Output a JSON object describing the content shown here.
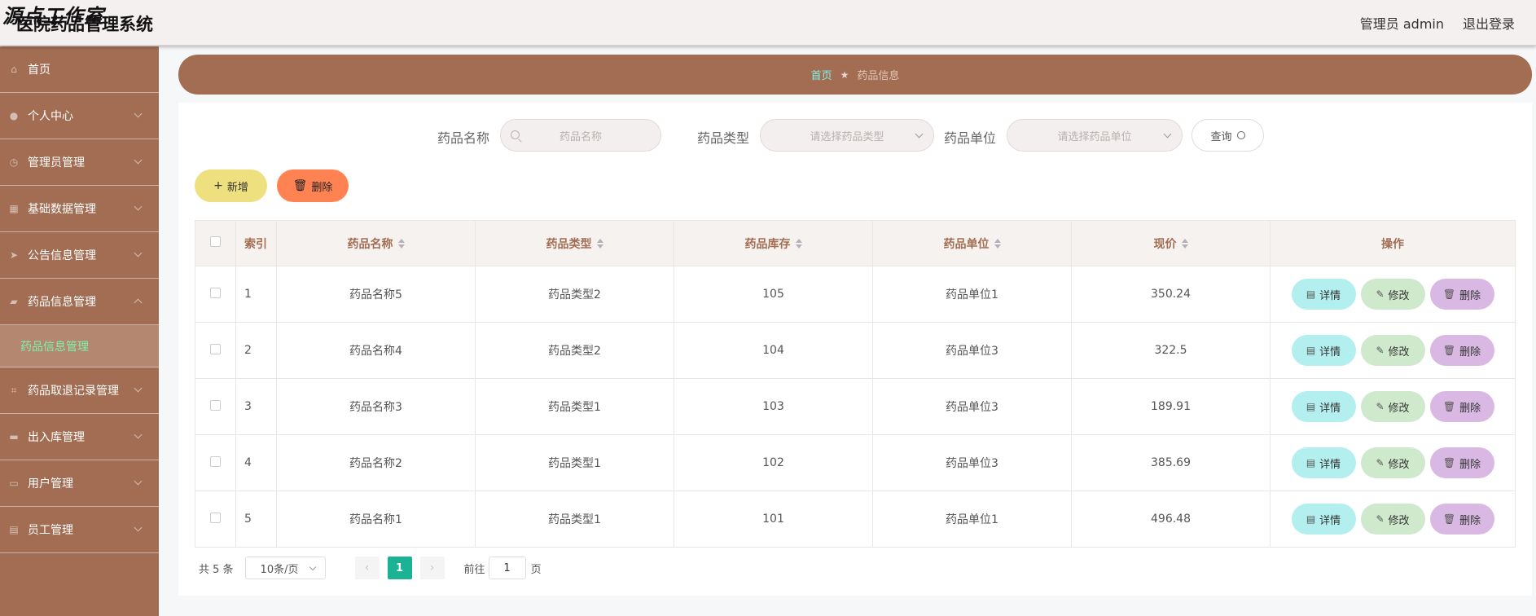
{
  "header": {
    "watermark": "源点工作室",
    "app_title": "医院药品管理系统",
    "user": "管理员 admin",
    "logout": "退出登录"
  },
  "sidebar": {
    "items": [
      {
        "label": "首页",
        "icon": "home-icon",
        "glyph": "⌂",
        "expandable": false
      },
      {
        "label": "个人中心",
        "icon": "user-icon",
        "glyph": "●",
        "expandable": true
      },
      {
        "label": "管理员管理",
        "icon": "clock-icon",
        "glyph": "◷",
        "expandable": true
      },
      {
        "label": "基础数据管理",
        "icon": "grid-icon",
        "glyph": "▦",
        "expandable": true
      },
      {
        "label": "公告信息管理",
        "icon": "send-icon",
        "glyph": "➤",
        "expandable": true
      },
      {
        "label": "药品信息管理",
        "icon": "folder-icon",
        "glyph": "▰",
        "expandable": true,
        "expanded": true
      },
      {
        "label": "药品取退记录管理",
        "icon": "crop-icon",
        "glyph": "⌗",
        "expandable": true
      },
      {
        "label": "出入库管理",
        "icon": "ticket-icon",
        "glyph": "▬",
        "expandable": true
      },
      {
        "label": "用户管理",
        "icon": "monitor-icon",
        "glyph": "▭",
        "expandable": true
      },
      {
        "label": "员工管理",
        "icon": "clipboard-icon",
        "glyph": "▤",
        "expandable": true
      }
    ],
    "active_sub": "药品信息管理"
  },
  "breadcrumb": {
    "home": "首页",
    "separator": "★",
    "current": "药品信息"
  },
  "search": {
    "name_label": "药品名称",
    "name_placeholder": "药品名称",
    "type_label": "药品类型",
    "type_placeholder": "请选择药品类型",
    "unit_label": "药品单位",
    "unit_placeholder": "请选择药品单位",
    "query_label": "查询"
  },
  "toolbar": {
    "add_label": "新增",
    "delete_label": "删除"
  },
  "table": {
    "headers": [
      "索引",
      "药品名称",
      "药品类型",
      "药品库存",
      "药品单位",
      "现价",
      "操作"
    ],
    "rows": [
      {
        "index": "1",
        "name": "药品名称5",
        "type": "药品类型2",
        "stock": "105",
        "unit": "药品单位1",
        "price": "350.24"
      },
      {
        "index": "2",
        "name": "药品名称4",
        "type": "药品类型2",
        "stock": "104",
        "unit": "药品单位3",
        "price": "322.5"
      },
      {
        "index": "3",
        "name": "药品名称3",
        "type": "药品类型1",
        "stock": "103",
        "unit": "药品单位3",
        "price": "189.91"
      },
      {
        "index": "4",
        "name": "药品名称2",
        "type": "药品类型1",
        "stock": "102",
        "unit": "药品单位3",
        "price": "385.69"
      },
      {
        "index": "5",
        "name": "药品名称1",
        "type": "药品类型1",
        "stock": "101",
        "unit": "药品单位1",
        "price": "496.48"
      }
    ],
    "actions": {
      "detail": "详情",
      "edit": "修改",
      "delete": "删除"
    }
  },
  "pagination": {
    "total": "共 5 条",
    "page_size": "10条/页",
    "current_page": "1",
    "goto_label": "前往",
    "goto_value": "1",
    "page_suffix": "页"
  },
  "colors": {
    "brand": "#a26d52",
    "accent": "#1bb394",
    "active_text": "#7ef3ad"
  }
}
